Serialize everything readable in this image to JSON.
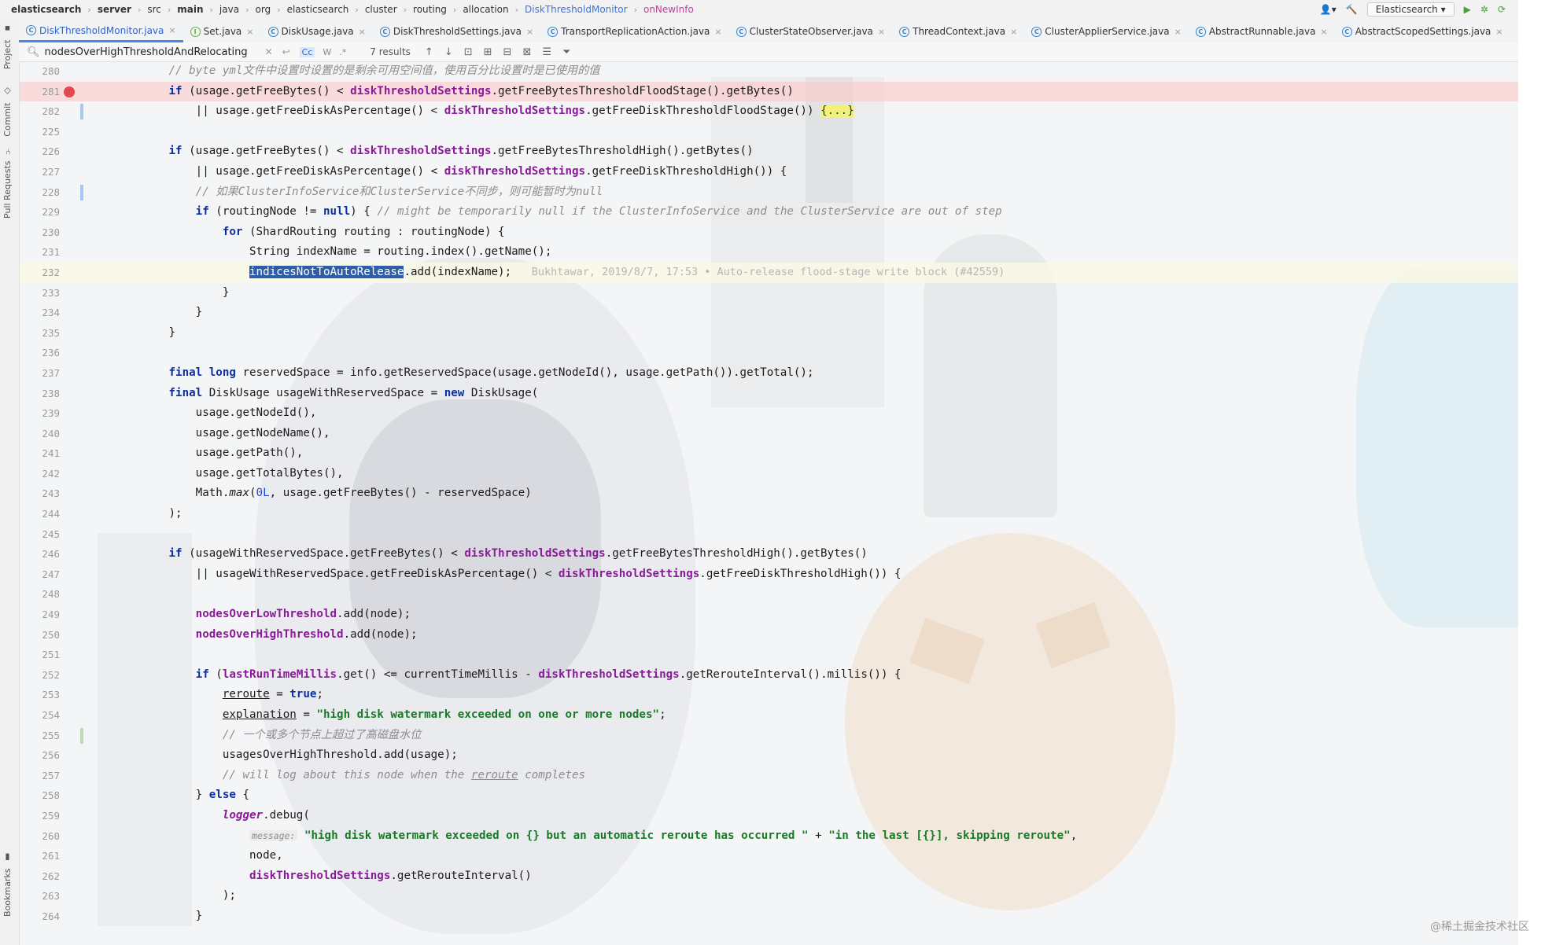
{
  "navbar": {
    "crumbs": [
      {
        "text": "elasticsearch",
        "style": "bold"
      },
      {
        "text": "server",
        "style": "bold"
      },
      {
        "text": "src",
        "style": ""
      },
      {
        "text": "main",
        "style": "bold"
      },
      {
        "text": "java",
        "style": ""
      },
      {
        "text": "org",
        "style": ""
      },
      {
        "text": "elasticsearch",
        "style": ""
      },
      {
        "text": "cluster",
        "style": ""
      },
      {
        "text": "routing",
        "style": ""
      },
      {
        "text": "allocation",
        "style": ""
      },
      {
        "text": "DiskThresholdMonitor",
        "style": "link"
      },
      {
        "text": "onNewInfo",
        "style": "method"
      }
    ],
    "run_config": "Elasticsearch"
  },
  "sidebar_tabs": {
    "project": "Project",
    "commit": "Commit",
    "pull_requests": "Pull Requests",
    "bookmarks": "Bookmarks"
  },
  "tabs": [
    {
      "label": "DiskThresholdMonitor.java",
      "active": true,
      "kind": "class"
    },
    {
      "label": "Set.java",
      "active": false,
      "kind": "interface"
    },
    {
      "label": "DiskUsage.java",
      "active": false,
      "kind": "class"
    },
    {
      "label": "DiskThresholdSettings.java",
      "active": false,
      "kind": "class"
    },
    {
      "label": "TransportReplicationAction.java",
      "active": false,
      "kind": "class"
    },
    {
      "label": "ClusterStateObserver.java",
      "active": false,
      "kind": "class"
    },
    {
      "label": "ThreadContext.java",
      "active": false,
      "kind": "class"
    },
    {
      "label": "ClusterApplierService.java",
      "active": false,
      "kind": "class"
    },
    {
      "label": "AbstractRunnable.java",
      "active": false,
      "kind": "class"
    },
    {
      "label": "AbstractScopedSettings.java",
      "active": false,
      "kind": "class"
    }
  ],
  "search": {
    "query": "nodesOverHighThresholdAndRelocating",
    "results": "7 results",
    "opt_case": "Cc",
    "opt_word": "W",
    "opt_regex": ".*"
  },
  "editor": {
    "lines": [
      {
        "n": "280",
        "t": [
          [
            "cmt",
            "            // byte yml文件中设置时设置的是剩余可用空间值，使用百分比设置时是已使用的值"
          ]
        ]
      },
      {
        "n": "281",
        "breakpoint": true,
        "t": [
          [
            "",
            "            "
          ],
          [
            "kw",
            "if"
          ],
          [
            "",
            " (usage.getFreeBytes() < "
          ],
          [
            "fld",
            "diskThresholdSettings"
          ],
          [
            "",
            ".getFreeBytesThresholdFloodStage().getBytes()"
          ]
        ]
      },
      {
        "n": "282",
        "marker": "blue",
        "t": [
          [
            "",
            "                || usage.getFreeDiskAsPercentage() < "
          ],
          [
            "fld",
            "diskThresholdSettings"
          ],
          [
            "",
            ".getFreeDiskThresholdFloodStage()) "
          ],
          [
            "fold",
            "{...}"
          ]
        ]
      },
      {
        "n": "225",
        "t": []
      },
      {
        "n": "226",
        "t": [
          [
            "",
            "            "
          ],
          [
            "kw",
            "if"
          ],
          [
            "",
            " (usage.getFreeBytes() < "
          ],
          [
            "fld",
            "diskThresholdSettings"
          ],
          [
            "",
            ".getFreeBytesThresholdHigh().getBytes()"
          ]
        ]
      },
      {
        "n": "227",
        "t": [
          [
            "",
            "                || usage.getFreeDiskAsPercentage() < "
          ],
          [
            "fld",
            "diskThresholdSettings"
          ],
          [
            "",
            ".getFreeDiskThresholdHigh()) {"
          ]
        ]
      },
      {
        "n": "228",
        "marker": "blue",
        "t": [
          [
            "cmt",
            "                // 如果ClusterInfoService和ClusterService不同步，则可能暂时为null"
          ]
        ]
      },
      {
        "n": "229",
        "t": [
          [
            "",
            "                "
          ],
          [
            "kw",
            "if"
          ],
          [
            "",
            " (routingNode != "
          ],
          [
            "kw",
            "null"
          ],
          [
            "",
            ") { "
          ],
          [
            "cmt",
            "// might be temporarily null if the ClusterInfoService and the ClusterService are out of step"
          ]
        ]
      },
      {
        "n": "230",
        "t": [
          [
            "",
            "                    "
          ],
          [
            "kw",
            "for"
          ],
          [
            "",
            " (ShardRouting routing : routingNode) {"
          ]
        ]
      },
      {
        "n": "231",
        "t": [
          [
            "",
            "                        String indexName = routing.index().getName();"
          ]
        ]
      },
      {
        "n": "232",
        "current": true,
        "t": [
          [
            "",
            "                        "
          ],
          [
            "sel",
            "indicesNotToAutoRelease"
          ],
          [
            "",
            ".add(indexName);   "
          ],
          [
            "blame",
            "Bukhtawar, 2019/8/7, 17:53 • Auto-release flood-stage write block (#42559)"
          ]
        ]
      },
      {
        "n": "233",
        "t": [
          [
            "",
            "                    }"
          ]
        ]
      },
      {
        "n": "234",
        "t": [
          [
            "",
            "                }"
          ]
        ]
      },
      {
        "n": "235",
        "t": [
          [
            "",
            "            }"
          ]
        ]
      },
      {
        "n": "236",
        "t": []
      },
      {
        "n": "237",
        "t": [
          [
            "",
            "            "
          ],
          [
            "kw",
            "final long"
          ],
          [
            "",
            " reservedSpace = info.getReservedSpace(usage.getNodeId(), usage.getPath()).getTotal();"
          ]
        ]
      },
      {
        "n": "238",
        "t": [
          [
            "",
            "            "
          ],
          [
            "kw",
            "final"
          ],
          [
            "",
            " DiskUsage usageWithReservedSpace = "
          ],
          [
            "kw",
            "new"
          ],
          [
            "",
            " DiskUsage("
          ]
        ]
      },
      {
        "n": "239",
        "t": [
          [
            "",
            "                usage.getNodeId(),"
          ]
        ]
      },
      {
        "n": "240",
        "t": [
          [
            "",
            "                usage.getNodeName(),"
          ]
        ]
      },
      {
        "n": "241",
        "t": [
          [
            "",
            "                usage.getPath(),"
          ]
        ]
      },
      {
        "n": "242",
        "t": [
          [
            "",
            "                usage.getTotalBytes(),"
          ]
        ]
      },
      {
        "n": "243",
        "t": [
          [
            "",
            "                Math."
          ],
          [
            "it",
            "max"
          ],
          [
            "",
            "("
          ],
          [
            "num",
            "0L"
          ],
          [
            "",
            ", usage.getFreeBytes() - reservedSpace)"
          ]
        ]
      },
      {
        "n": "244",
        "t": [
          [
            "",
            "            );"
          ]
        ]
      },
      {
        "n": "245",
        "t": []
      },
      {
        "n": "246",
        "t": [
          [
            "",
            "            "
          ],
          [
            "kw",
            "if"
          ],
          [
            "",
            " (usageWithReservedSpace.getFreeBytes() < "
          ],
          [
            "fld",
            "diskThresholdSettings"
          ],
          [
            "",
            ".getFreeBytesThresholdHigh().getBytes()"
          ]
        ]
      },
      {
        "n": "247",
        "t": [
          [
            "",
            "                || usageWithReservedSpace.getFreeDiskAsPercentage() < "
          ],
          [
            "fld",
            "diskThresholdSettings"
          ],
          [
            "",
            ".getFreeDiskThresholdHigh()) {"
          ]
        ]
      },
      {
        "n": "248",
        "t": []
      },
      {
        "n": "249",
        "t": [
          [
            "",
            "                "
          ],
          [
            "fld",
            "nodesOverLowThreshold"
          ],
          [
            "",
            ".add(node);"
          ]
        ]
      },
      {
        "n": "250",
        "t": [
          [
            "",
            "                "
          ],
          [
            "fld",
            "nodesOverHighThreshold"
          ],
          [
            "",
            ".add(node);"
          ]
        ]
      },
      {
        "n": "251",
        "t": []
      },
      {
        "n": "252",
        "t": [
          [
            "",
            "                "
          ],
          [
            "kw",
            "if"
          ],
          [
            "",
            " ("
          ],
          [
            "fld",
            "lastRunTimeMillis"
          ],
          [
            "",
            ".get() <= currentTimeMillis - "
          ],
          [
            "fld",
            "diskThresholdSettings"
          ],
          [
            "",
            ".getRerouteInterval().millis()) {"
          ]
        ]
      },
      {
        "n": "253",
        "t": [
          [
            "",
            "                    "
          ],
          [
            "u",
            "reroute"
          ],
          [
            "",
            " = "
          ],
          [
            "kw",
            "true"
          ],
          [
            "",
            ";"
          ]
        ]
      },
      {
        "n": "254",
        "t": [
          [
            "",
            "                    "
          ],
          [
            "u",
            "explanation"
          ],
          [
            "",
            " = "
          ],
          [
            "str",
            "\"high disk watermark exceeded on one or more nodes\""
          ],
          [
            "",
            ";"
          ]
        ]
      },
      {
        "n": "255",
        "marker": "green",
        "t": [
          [
            "cmt",
            "                    // 一个或多个节点上超过了高磁盘水位"
          ]
        ]
      },
      {
        "n": "256",
        "t": [
          [
            "",
            "                    usagesOverHighThreshold.add(usage);"
          ]
        ]
      },
      {
        "n": "257",
        "t": [
          [
            "cmt",
            "                    // will log about this node when the "
          ],
          [
            "cmt u",
            "reroute"
          ],
          [
            "cmt",
            " completes"
          ]
        ]
      },
      {
        "n": "258",
        "t": [
          [
            "",
            "                } "
          ],
          [
            "kw",
            "else"
          ],
          [
            "",
            " {"
          ]
        ]
      },
      {
        "n": "259",
        "t": [
          [
            "",
            "                    "
          ],
          [
            "fld it",
            "logger"
          ],
          [
            "",
            ".debug("
          ]
        ]
      },
      {
        "n": "260",
        "t": [
          [
            "",
            "                        "
          ],
          [
            "hint",
            "message:"
          ],
          [
            "",
            " "
          ],
          [
            "str",
            "\"high disk watermark exceeded on {} but an automatic reroute has occurred \""
          ],
          [
            "",
            " + "
          ],
          [
            "str",
            "\"in the last [{}], skipping reroute\""
          ],
          [
            "",
            ","
          ]
        ]
      },
      {
        "n": "261",
        "t": [
          [
            "",
            "                        node,"
          ]
        ]
      },
      {
        "n": "262",
        "t": [
          [
            "",
            "                        "
          ],
          [
            "fld",
            "diskThresholdSettings"
          ],
          [
            "",
            ".getRerouteInterval()"
          ]
        ]
      },
      {
        "n": "263",
        "t": [
          [
            "",
            "                    );"
          ]
        ]
      },
      {
        "n": "264",
        "t": [
          [
            "",
            "                }"
          ]
        ]
      }
    ]
  },
  "watermark": "@稀土掘金技术社区"
}
